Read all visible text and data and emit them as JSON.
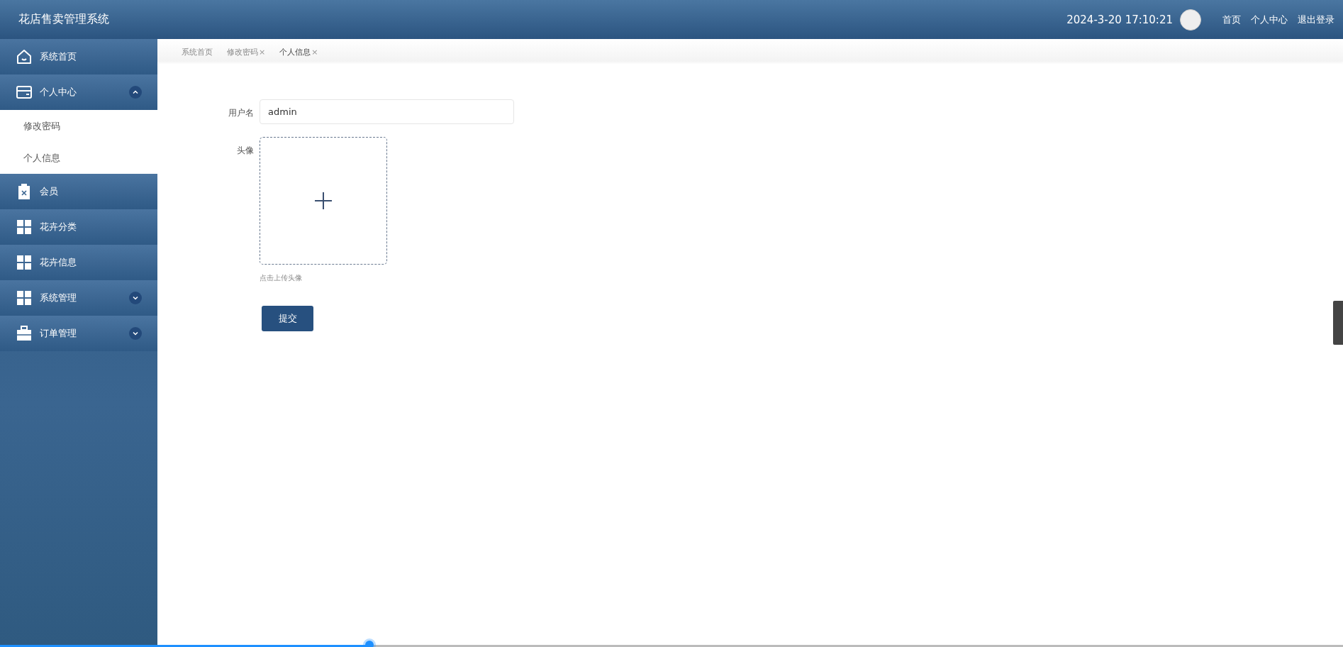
{
  "header": {
    "title": "花店售卖管理系统",
    "datetime": "2024-3-20 17:10:21",
    "links": [
      "首页",
      "个人中心",
      "退出登录"
    ]
  },
  "sidebar": {
    "items": [
      {
        "label": "系统首页",
        "kind": "home"
      },
      {
        "label": "个人中心",
        "kind": "card",
        "expanded": true,
        "children": [
          {
            "label": "修改密码"
          },
          {
            "label": "个人信息"
          }
        ]
      },
      {
        "label": "会员",
        "kind": "clipboard"
      },
      {
        "label": "花卉分类",
        "kind": "grid"
      },
      {
        "label": "花卉信息",
        "kind": "grid"
      },
      {
        "label": "系统管理",
        "kind": "grid",
        "expanded": false
      },
      {
        "label": "订单管理",
        "kind": "briefcase",
        "expanded": false
      }
    ]
  },
  "tabs": [
    {
      "label": "系统首页",
      "selected": false
    },
    {
      "label": "修改密码",
      "close": "×",
      "selected": false
    },
    {
      "label": "个人信息",
      "close": "×",
      "selected": true
    }
  ],
  "form": {
    "fields": [
      {
        "kind": "text",
        "label": "用户名",
        "value": "admin"
      },
      {
        "kind": "upload",
        "label": "头像",
        "hint": "点击上传头像"
      }
    ],
    "submit": "提交"
  },
  "playback": {
    "level": 0.275
  }
}
